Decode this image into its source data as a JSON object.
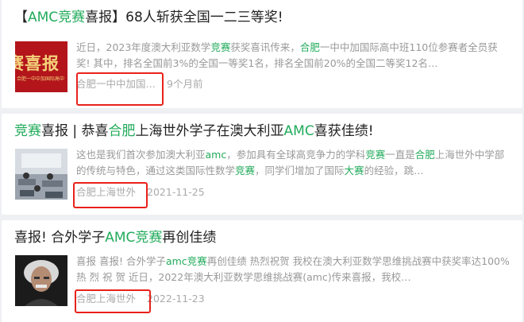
{
  "results": [
    {
      "title_parts": [
        {
          "text": "【",
          "hl": false
        },
        {
          "text": "AMC竞赛",
          "hl": true
        },
        {
          "text": "喜报】68人斩获全国一二三等奖!",
          "hl": false
        }
      ],
      "thumb_text": "赛喜报",
      "thumb_subtext": "合肥一中中加国际高中",
      "snippet_parts": [
        {
          "text": "近日，2023年度澳大利亚数学",
          "hl": false
        },
        {
          "text": "竞赛",
          "hl": true
        },
        {
          "text": "获奖喜讯传来，",
          "hl": false
        },
        {
          "text": "合肥",
          "hl": true
        },
        {
          "text": "一中中加国际高中班110位参赛者全员获奖! 其中，排名全国前3%的全国一等奖1名，排名全国前20%的全国二等奖12名…",
          "hl": false
        }
      ],
      "source": "合肥一中中加国…",
      "time": "9个月前"
    },
    {
      "title_parts": [
        {
          "text": "竞赛",
          "hl": true
        },
        {
          "text": "喜报 | 恭喜",
          "hl": false
        },
        {
          "text": "合肥",
          "hl": true
        },
        {
          "text": "上海世外学子在澳大利亚",
          "hl": false
        },
        {
          "text": "AMC",
          "hl": true
        },
        {
          "text": "喜获佳绩!",
          "hl": false
        }
      ],
      "snippet_parts": [
        {
          "text": "这也是我们首次参加澳大利亚",
          "hl": false
        },
        {
          "text": "amc",
          "hl": true
        },
        {
          "text": "，参加具有全球高竞争力的学科",
          "hl": false
        },
        {
          "text": "竞赛",
          "hl": true
        },
        {
          "text": "一直是",
          "hl": false
        },
        {
          "text": "合肥",
          "hl": true
        },
        {
          "text": "上海世外中学部的传统与特色，通过这类国际性数学",
          "hl": false
        },
        {
          "text": "竞赛",
          "hl": true
        },
        {
          "text": "，同学们增加了国际",
          "hl": false
        },
        {
          "text": "大赛",
          "hl": true
        },
        {
          "text": "的经验，跳…",
          "hl": false
        }
      ],
      "source": "合肥上海世外",
      "time": "2021-11-25"
    },
    {
      "title_parts": [
        {
          "text": "喜报! 合外学子",
          "hl": false
        },
        {
          "text": "AMC竞赛",
          "hl": true
        },
        {
          "text": "再创佳绩",
          "hl": false
        }
      ],
      "snippet_parts": [
        {
          "text": "喜报 喜报! 合外学子",
          "hl": false
        },
        {
          "text": "amc竞赛",
          "hl": true
        },
        {
          "text": "再创佳绩 热烈祝贺 我校在澳大利亚数学思维挑战赛中获奖率达100%热 烈 祝 贺 近日，2022年澳大利亚数学思维挑战赛(amc)传来喜报，我校…",
          "hl": false
        }
      ],
      "source": "合肥上海世外",
      "time": "2022-11-23"
    }
  ],
  "colors": {
    "highlight": "#22ab5b",
    "annotation": "#e8221b"
  }
}
